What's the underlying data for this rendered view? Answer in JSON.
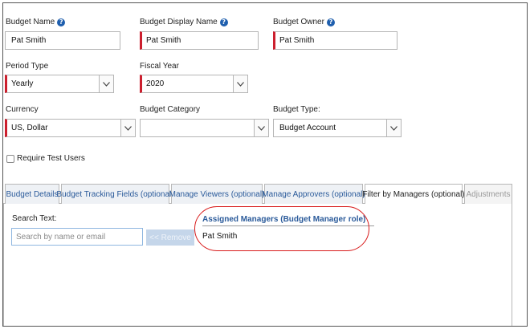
{
  "fields": {
    "budget_name": {
      "label": "Budget Name",
      "value": "Pat Smith"
    },
    "budget_display_name": {
      "label": "Budget Display Name",
      "value": "Pat Smith"
    },
    "budget_owner": {
      "label": "Budget Owner",
      "value": "Pat Smith"
    },
    "period_type": {
      "label": "Period Type",
      "value": "Yearly"
    },
    "fiscal_year": {
      "label": "Fiscal Year",
      "value": "2020"
    },
    "currency": {
      "label": "Currency",
      "value": "US, Dollar"
    },
    "budget_category": {
      "label": "Budget Category",
      "value": ""
    },
    "budget_type": {
      "label": "Budget Type:",
      "value": "Budget Account"
    }
  },
  "require_test_users": {
    "label": "Require Test Users",
    "checked": false
  },
  "tabs": [
    {
      "label": "Budget Details"
    },
    {
      "label": "Budget Tracking Fields (optional)"
    },
    {
      "label": "Manage Viewers (optional)"
    },
    {
      "label": "Manage Approvers (optional)"
    },
    {
      "label": "Filter by Managers (optional)"
    },
    {
      "label": "Adjustments"
    }
  ],
  "managers_panel": {
    "search_label": "Search Text:",
    "search_placeholder": "Search by name or email",
    "search_value": "",
    "remove_label": "<< Remove",
    "assigned_header": "Assigned Managers (Budget Manager role)",
    "assigned": [
      "Pat Smith"
    ]
  },
  "colors": {
    "required_marker": "#cc1f2e",
    "link": "#2a5a9a",
    "help_icon": "#1f5fae",
    "highlight": "#d81b1b"
  },
  "icons": {
    "help": "question-circle-icon",
    "dropdown": "chevron-down-icon"
  }
}
